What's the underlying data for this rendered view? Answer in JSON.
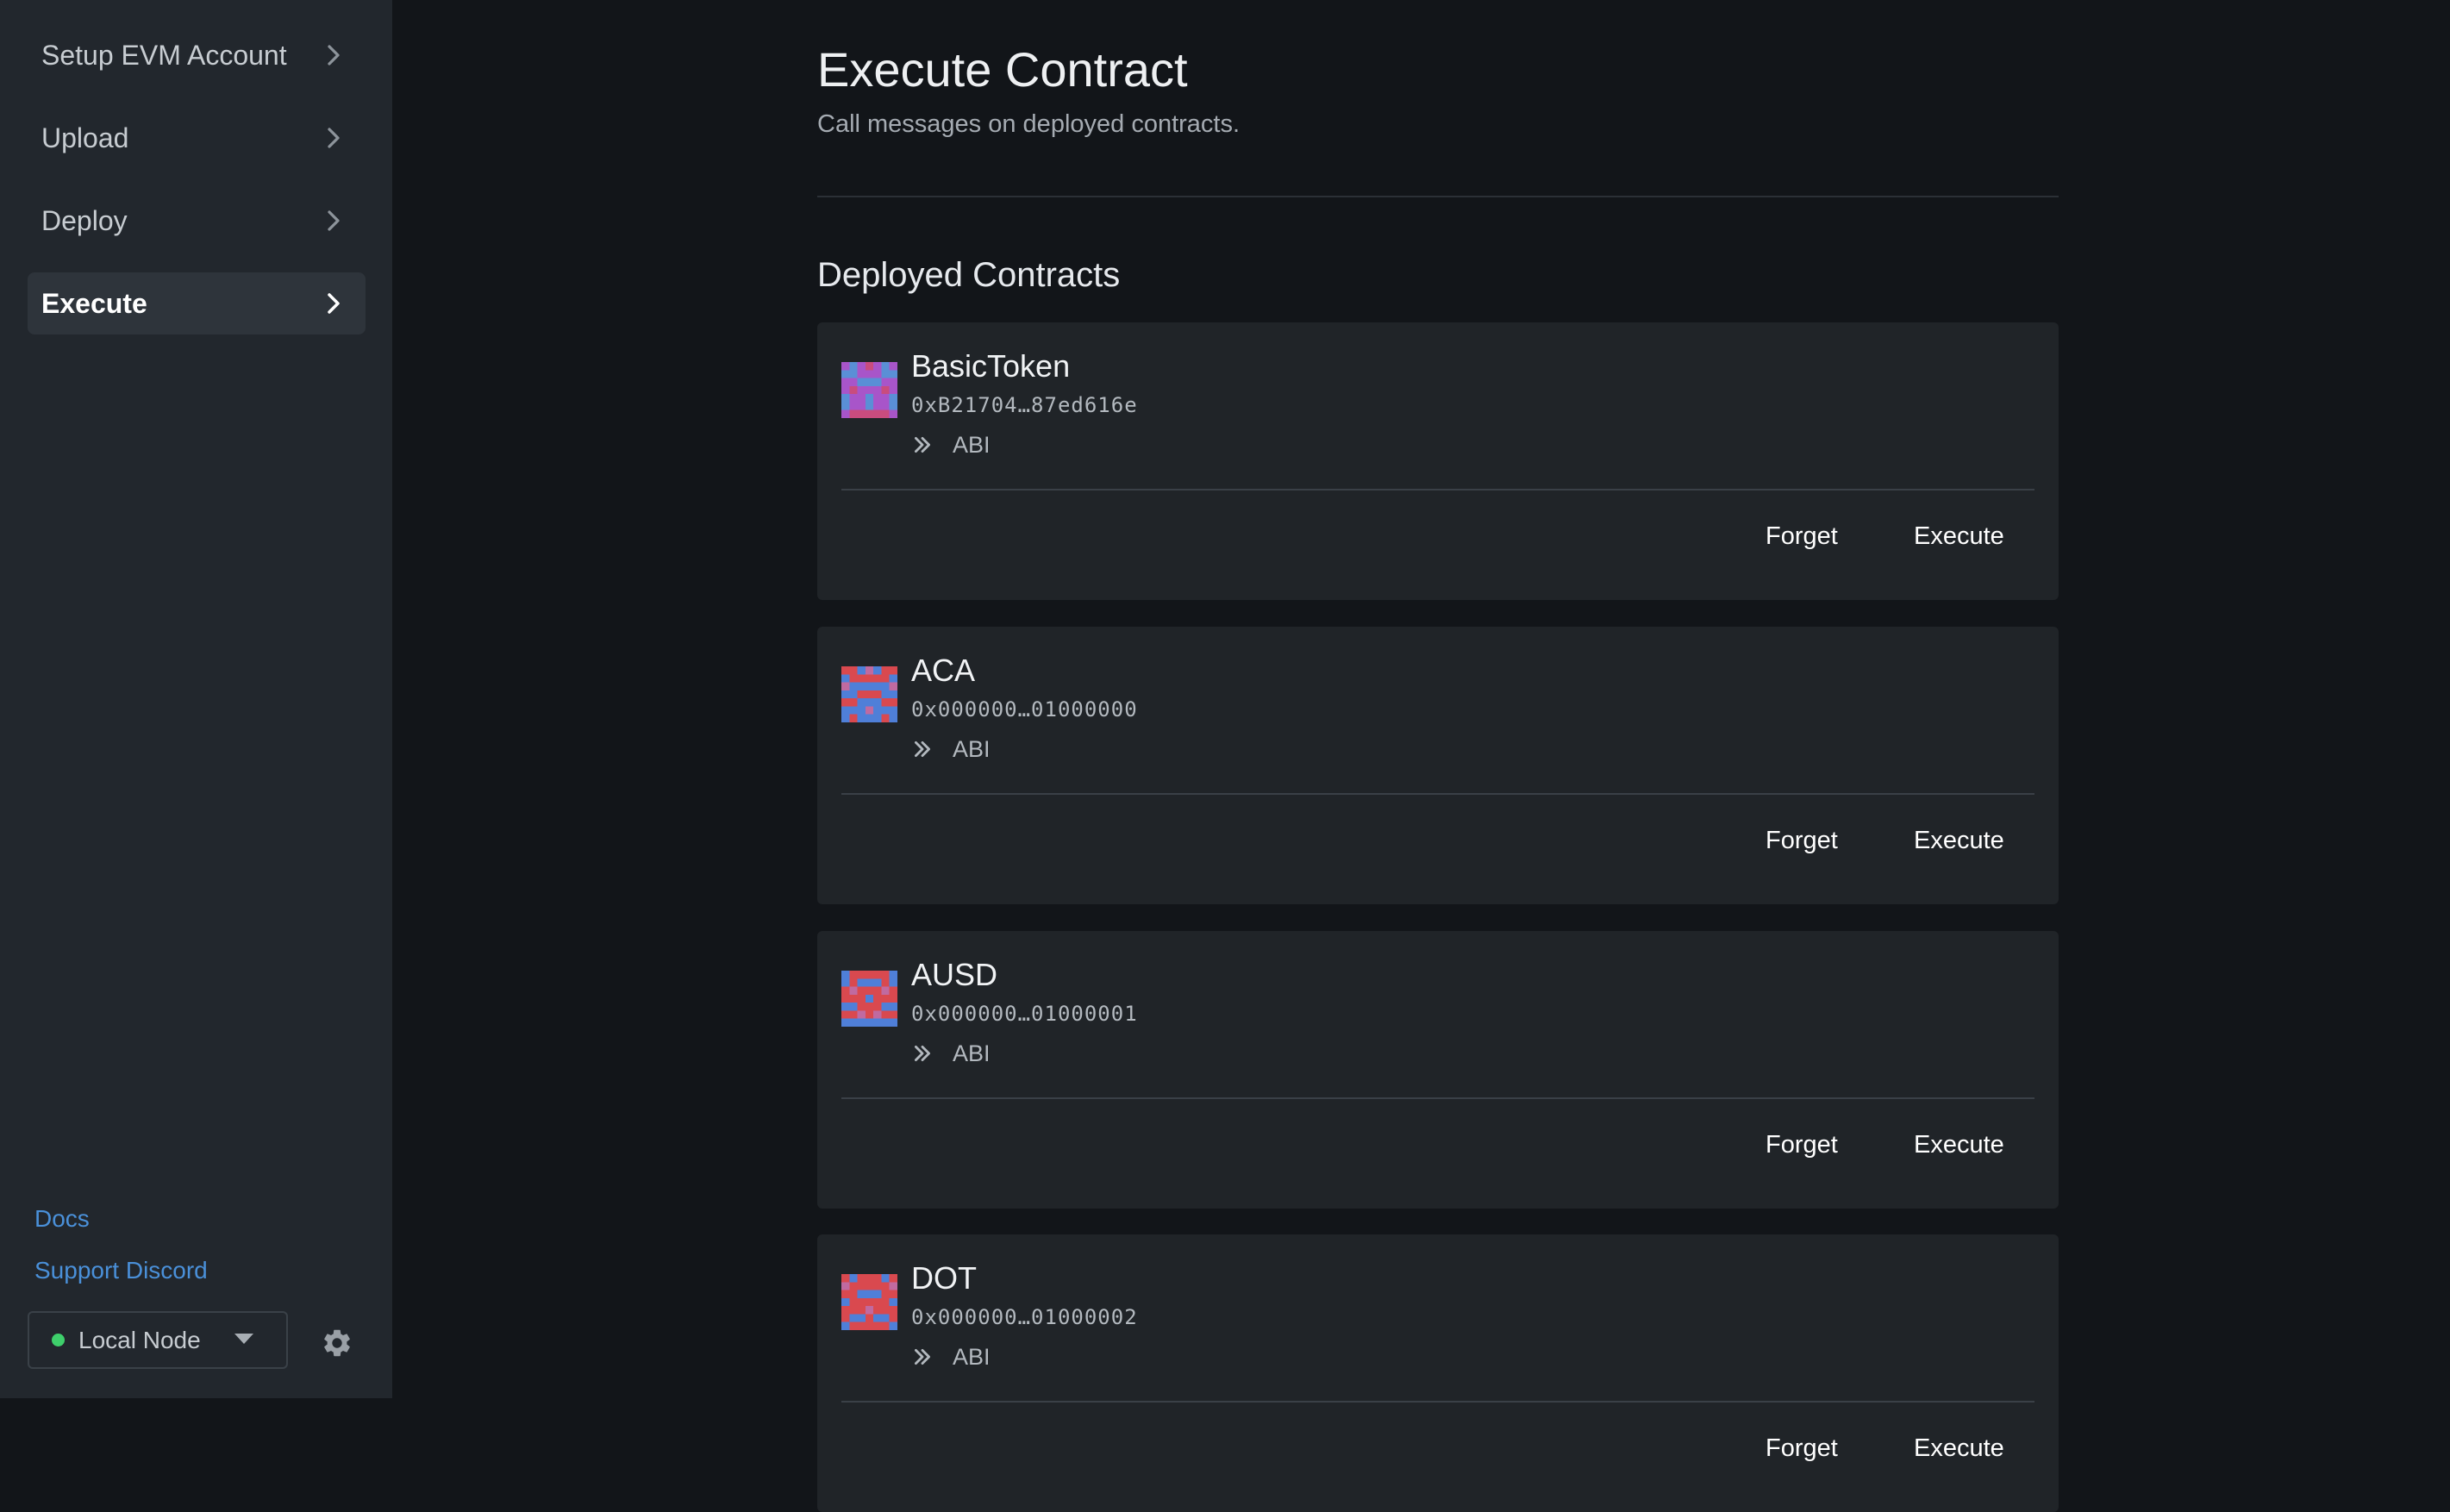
{
  "sidebar": {
    "nav": [
      {
        "label": "Setup EVM Account",
        "active": false
      },
      {
        "label": "Upload",
        "active": false
      },
      {
        "label": "Deploy",
        "active": false
      },
      {
        "label": "Execute",
        "active": true
      }
    ],
    "links": {
      "docs": "Docs",
      "support": "Support Discord"
    },
    "node": {
      "label": "Local Node",
      "status_color": "#3ecf6b"
    }
  },
  "main": {
    "title": "Execute Contract",
    "subtitle": "Call messages on deployed contracts.",
    "section_title": "Deployed Contracts",
    "contracts": [
      {
        "name": "BasicToken",
        "address": "0xB21704…87ed616e",
        "abi_label": "ABI",
        "forget_label": "Forget",
        "execute_label": "Execute"
      },
      {
        "name": "ACA",
        "address": "0x000000…01000000",
        "abi_label": "ABI",
        "forget_label": "Forget",
        "execute_label": "Execute"
      },
      {
        "name": "AUSD",
        "address": "0x000000…01000001",
        "abi_label": "ABI",
        "forget_label": "Forget",
        "execute_label": "Execute"
      },
      {
        "name": "DOT",
        "address": "0x000000…01000002",
        "abi_label": "ABI",
        "forget_label": "Forget",
        "execute_label": "Execute"
      }
    ]
  },
  "icons": {
    "nav_chevron": "chevron-right-icon",
    "abi_expand": "double-chevron-right-icon",
    "settings": "gear-icon",
    "node_caret": "caret-down-icon",
    "contract_avatar": "identicon-icon"
  },
  "colors": {
    "link": "#4a90d9",
    "background": "#121519",
    "sidebar": "#22272d",
    "card": "#202428"
  }
}
